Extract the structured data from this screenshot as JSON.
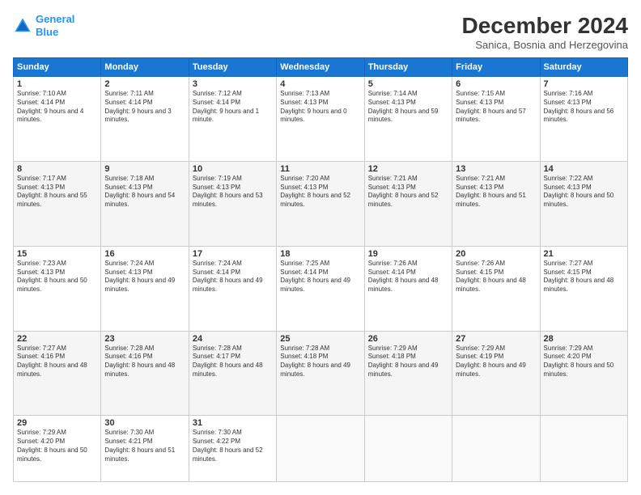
{
  "header": {
    "logo_line1": "General",
    "logo_line2": "Blue",
    "month_title": "December 2024",
    "location": "Sanica, Bosnia and Herzegovina"
  },
  "weekdays": [
    "Sunday",
    "Monday",
    "Tuesday",
    "Wednesday",
    "Thursday",
    "Friday",
    "Saturday"
  ],
  "weeks": [
    [
      {
        "day": 1,
        "sunrise": "7:10 AM",
        "sunset": "4:14 PM",
        "daylight": "9 hours and 4 minutes."
      },
      {
        "day": 2,
        "sunrise": "7:11 AM",
        "sunset": "4:14 PM",
        "daylight": "9 hours and 3 minutes."
      },
      {
        "day": 3,
        "sunrise": "7:12 AM",
        "sunset": "4:14 PM",
        "daylight": "9 hours and 1 minute."
      },
      {
        "day": 4,
        "sunrise": "7:13 AM",
        "sunset": "4:13 PM",
        "daylight": "9 hours and 0 minutes."
      },
      {
        "day": 5,
        "sunrise": "7:14 AM",
        "sunset": "4:13 PM",
        "daylight": "8 hours and 59 minutes."
      },
      {
        "day": 6,
        "sunrise": "7:15 AM",
        "sunset": "4:13 PM",
        "daylight": "8 hours and 57 minutes."
      },
      {
        "day": 7,
        "sunrise": "7:16 AM",
        "sunset": "4:13 PM",
        "daylight": "8 hours and 56 minutes."
      }
    ],
    [
      {
        "day": 8,
        "sunrise": "7:17 AM",
        "sunset": "4:13 PM",
        "daylight": "8 hours and 55 minutes."
      },
      {
        "day": 9,
        "sunrise": "7:18 AM",
        "sunset": "4:13 PM",
        "daylight": "8 hours and 54 minutes."
      },
      {
        "day": 10,
        "sunrise": "7:19 AM",
        "sunset": "4:13 PM",
        "daylight": "8 hours and 53 minutes."
      },
      {
        "day": 11,
        "sunrise": "7:20 AM",
        "sunset": "4:13 PM",
        "daylight": "8 hours and 52 minutes."
      },
      {
        "day": 12,
        "sunrise": "7:21 AM",
        "sunset": "4:13 PM",
        "daylight": "8 hours and 52 minutes."
      },
      {
        "day": 13,
        "sunrise": "7:21 AM",
        "sunset": "4:13 PM",
        "daylight": "8 hours and 51 minutes."
      },
      {
        "day": 14,
        "sunrise": "7:22 AM",
        "sunset": "4:13 PM",
        "daylight": "8 hours and 50 minutes."
      }
    ],
    [
      {
        "day": 15,
        "sunrise": "7:23 AM",
        "sunset": "4:13 PM",
        "daylight": "8 hours and 50 minutes."
      },
      {
        "day": 16,
        "sunrise": "7:24 AM",
        "sunset": "4:13 PM",
        "daylight": "8 hours and 49 minutes."
      },
      {
        "day": 17,
        "sunrise": "7:24 AM",
        "sunset": "4:14 PM",
        "daylight": "8 hours and 49 minutes."
      },
      {
        "day": 18,
        "sunrise": "7:25 AM",
        "sunset": "4:14 PM",
        "daylight": "8 hours and 49 minutes."
      },
      {
        "day": 19,
        "sunrise": "7:26 AM",
        "sunset": "4:14 PM",
        "daylight": "8 hours and 48 minutes."
      },
      {
        "day": 20,
        "sunrise": "7:26 AM",
        "sunset": "4:15 PM",
        "daylight": "8 hours and 48 minutes."
      },
      {
        "day": 21,
        "sunrise": "7:27 AM",
        "sunset": "4:15 PM",
        "daylight": "8 hours and 48 minutes."
      }
    ],
    [
      {
        "day": 22,
        "sunrise": "7:27 AM",
        "sunset": "4:16 PM",
        "daylight": "8 hours and 48 minutes."
      },
      {
        "day": 23,
        "sunrise": "7:28 AM",
        "sunset": "4:16 PM",
        "daylight": "8 hours and 48 minutes."
      },
      {
        "day": 24,
        "sunrise": "7:28 AM",
        "sunset": "4:17 PM",
        "daylight": "8 hours and 48 minutes."
      },
      {
        "day": 25,
        "sunrise": "7:28 AM",
        "sunset": "4:18 PM",
        "daylight": "8 hours and 49 minutes."
      },
      {
        "day": 26,
        "sunrise": "7:29 AM",
        "sunset": "4:18 PM",
        "daylight": "8 hours and 49 minutes."
      },
      {
        "day": 27,
        "sunrise": "7:29 AM",
        "sunset": "4:19 PM",
        "daylight": "8 hours and 49 minutes."
      },
      {
        "day": 28,
        "sunrise": "7:29 AM",
        "sunset": "4:20 PM",
        "daylight": "8 hours and 50 minutes."
      }
    ],
    [
      {
        "day": 29,
        "sunrise": "7:29 AM",
        "sunset": "4:20 PM",
        "daylight": "8 hours and 50 minutes."
      },
      {
        "day": 30,
        "sunrise": "7:30 AM",
        "sunset": "4:21 PM",
        "daylight": "8 hours and 51 minutes."
      },
      {
        "day": 31,
        "sunrise": "7:30 AM",
        "sunset": "4:22 PM",
        "daylight": "8 hours and 52 minutes."
      },
      null,
      null,
      null,
      null
    ]
  ]
}
